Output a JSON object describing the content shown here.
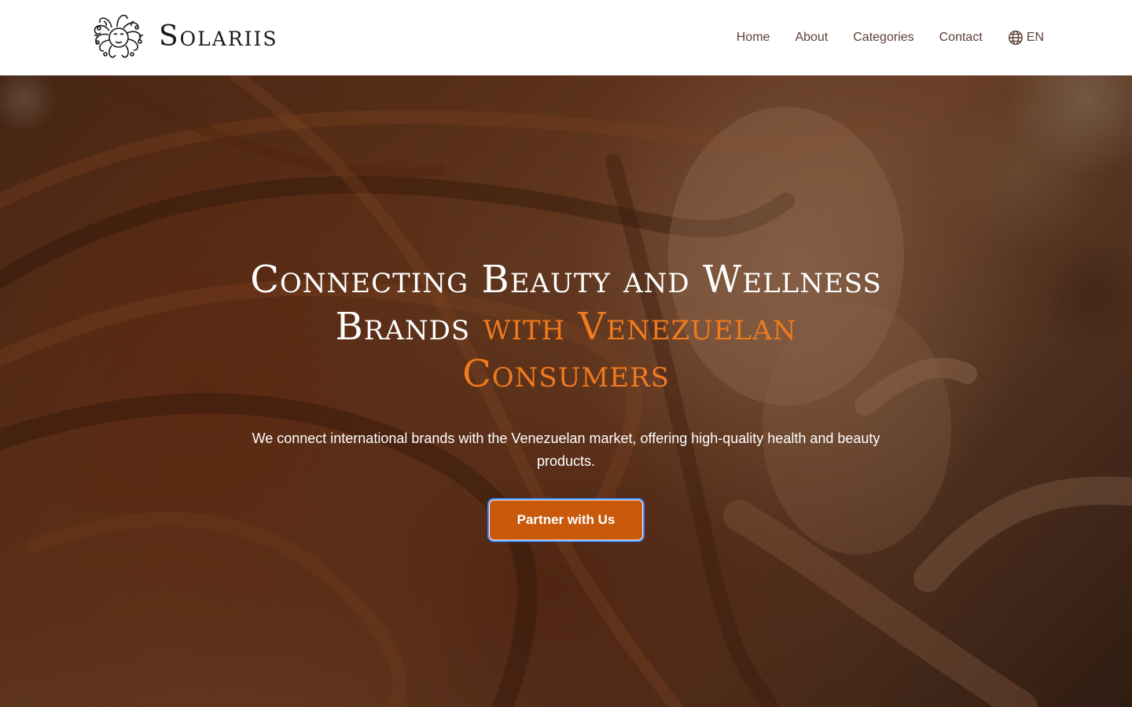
{
  "header": {
    "brand_name": "Solariis",
    "nav": {
      "home": "Home",
      "about": "About",
      "categories": "Categories",
      "contact": "Contact"
    },
    "language": "EN"
  },
  "hero": {
    "title_line1": "Connecting Beauty and Wellness",
    "title_brands": "Brands",
    "title_accent_1": "with Venezuelan",
    "title_accent_2": "Consumers",
    "subtitle": "We connect international brands with the Venezuelan market, offering high-quality health and beauty products.",
    "cta_label": "Partner with Us"
  },
  "colors": {
    "accent": "#f07a1e",
    "cta_background": "#c95a0c",
    "nav_text": "#5d4038",
    "focus_ring": "#3b82f6"
  },
  "icons": {
    "logo": "medusa-head-logo",
    "language": "globe-icon"
  }
}
